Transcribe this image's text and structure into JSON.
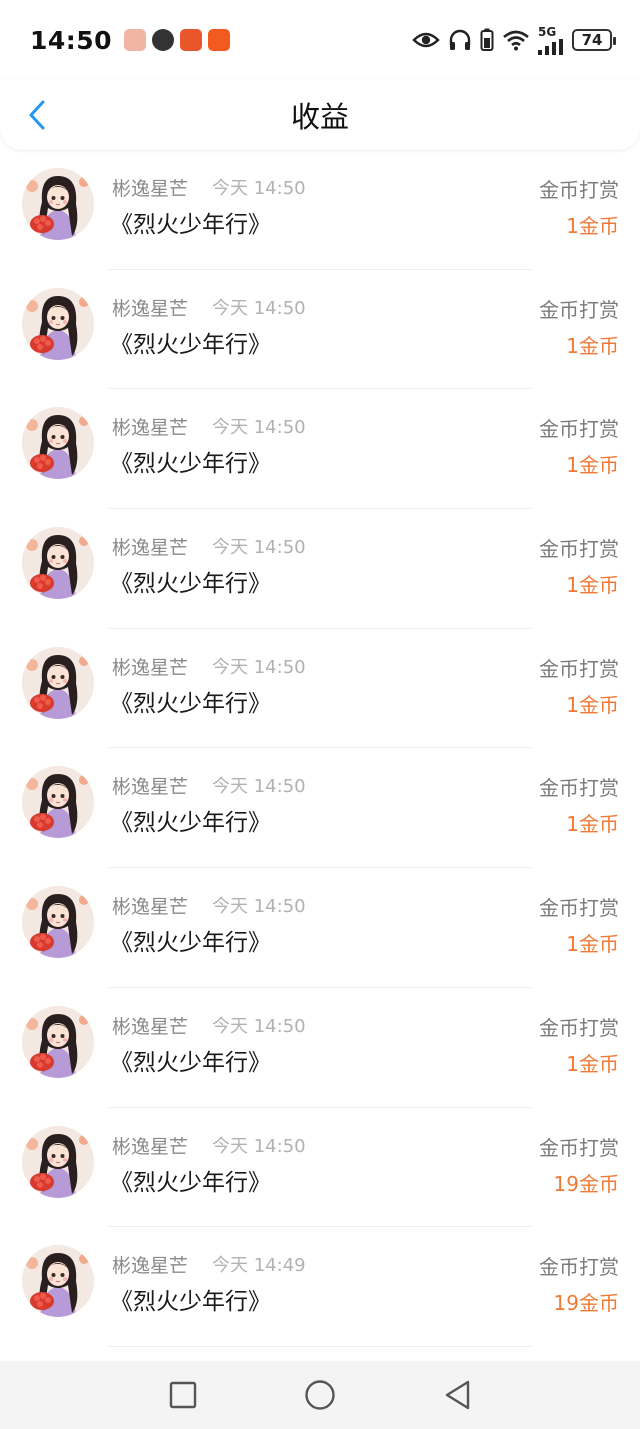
{
  "status_bar": {
    "time": "14:50",
    "five_g": "5G",
    "battery": "74",
    "notification_icons": [
      "photo-app-icon",
      "wechat-icon",
      "game-app-icon",
      "video-app-icon"
    ],
    "right_icons": [
      "eye-icon",
      "headphones-icon",
      "phone-battery-icon",
      "wifi-icon",
      "signal-icon"
    ]
  },
  "header": {
    "title": "收益",
    "back_icon": "chevron-left-icon",
    "accent_color": "#2196f3"
  },
  "colors": {
    "amount": "#f07a35",
    "name": "#8a8a8a",
    "time": "#b2b2b2"
  },
  "records": [
    {
      "user": "彬逸星芒",
      "time": "今天 14:50",
      "work": "《烈火少年行》",
      "type": "金币打赏",
      "amount": "1金币"
    },
    {
      "user": "彬逸星芒",
      "time": "今天 14:50",
      "work": "《烈火少年行》",
      "type": "金币打赏",
      "amount": "1金币"
    },
    {
      "user": "彬逸星芒",
      "time": "今天 14:50",
      "work": "《烈火少年行》",
      "type": "金币打赏",
      "amount": "1金币"
    },
    {
      "user": "彬逸星芒",
      "time": "今天 14:50",
      "work": "《烈火少年行》",
      "type": "金币打赏",
      "amount": "1金币"
    },
    {
      "user": "彬逸星芒",
      "time": "今天 14:50",
      "work": "《烈火少年行》",
      "type": "金币打赏",
      "amount": "1金币"
    },
    {
      "user": "彬逸星芒",
      "time": "今天 14:50",
      "work": "《烈火少年行》",
      "type": "金币打赏",
      "amount": "1金币"
    },
    {
      "user": "彬逸星芒",
      "time": "今天 14:50",
      "work": "《烈火少年行》",
      "type": "金币打赏",
      "amount": "1金币"
    },
    {
      "user": "彬逸星芒",
      "time": "今天 14:50",
      "work": "《烈火少年行》",
      "type": "金币打赏",
      "amount": "1金币"
    },
    {
      "user": "彬逸星芒",
      "time": "今天 14:50",
      "work": "《烈火少年行》",
      "type": "金币打赏",
      "amount": "19金币"
    },
    {
      "user": "彬逸星芒",
      "time": "今天 14:49",
      "work": "《烈火少年行》",
      "type": "金币打赏",
      "amount": "19金币"
    }
  ],
  "system_nav": {
    "buttons": [
      "recents-square-icon",
      "home-circle-icon",
      "back-triangle-icon"
    ]
  }
}
